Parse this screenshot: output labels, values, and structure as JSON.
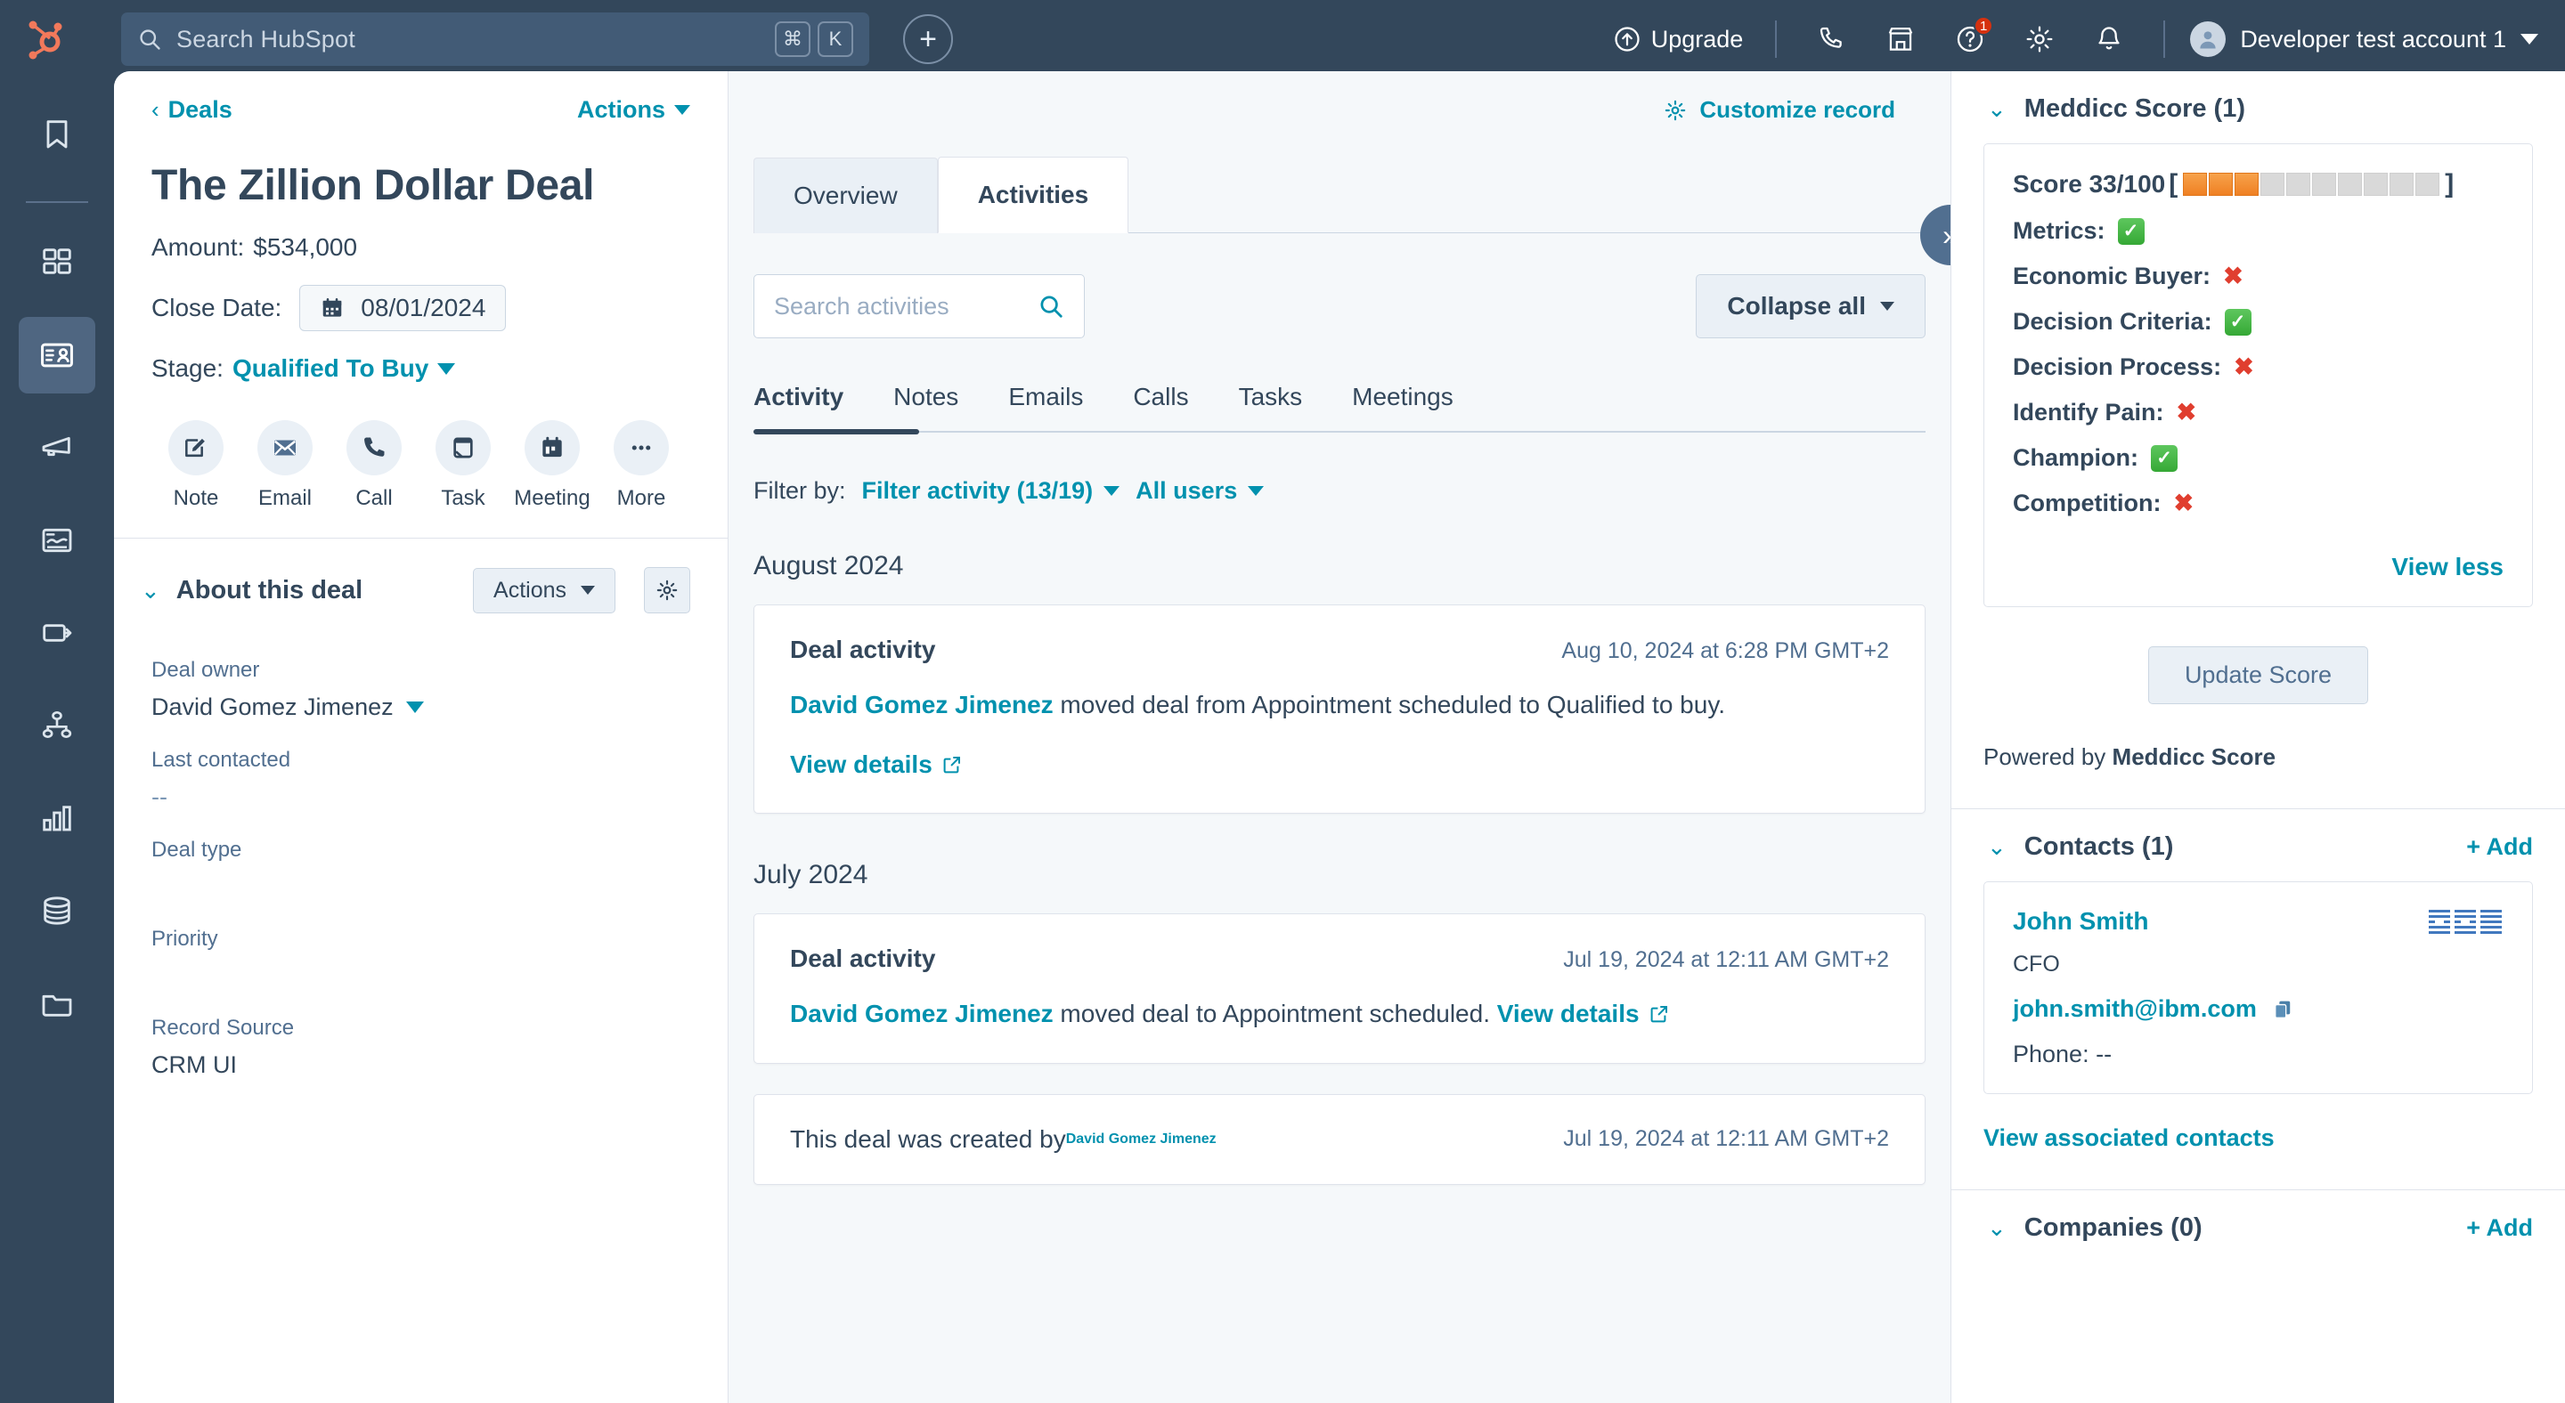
{
  "topnav": {
    "logo_name": "hubspot-logo",
    "search": {
      "placeholder": "Search HubSpot",
      "kbd_cmd": "⌘",
      "kbd_key": "K"
    },
    "create_label": "+",
    "upgrade_label": "Upgrade",
    "icons": [
      "phone-icon",
      "marketplace-icon",
      "help-icon",
      "settings-gear-icon",
      "notifications-bell-icon"
    ],
    "help_badge": "1",
    "account_name": "Developer test account 1"
  },
  "rail": {
    "items": [
      {
        "name": "bookmark-icon",
        "label": "Bookmarks",
        "active": false
      },
      {
        "name": "workspaces-icon",
        "label": "Workspaces",
        "active": false
      },
      {
        "name": "crm-contacts-icon",
        "label": "CRM",
        "active": true
      },
      {
        "name": "marketing-megaphone-icon",
        "label": "Marketing",
        "active": false
      },
      {
        "name": "content-icon",
        "label": "Content",
        "active": false
      },
      {
        "name": "commerce-tag-icon",
        "label": "Commerce",
        "active": false
      },
      {
        "name": "automation-icon",
        "label": "Automations",
        "active": false
      },
      {
        "name": "reporting-bars-icon",
        "label": "Reporting",
        "active": false
      },
      {
        "name": "data-management-icon",
        "label": "Data Management",
        "active": false
      },
      {
        "name": "library-folder-icon",
        "label": "Library",
        "active": false
      }
    ]
  },
  "left": {
    "breadcrumb": "Deals",
    "actions_label": "Actions",
    "deal_title": "The Zillion Dollar Deal",
    "amount_label": "Amount:",
    "amount_value": "$534,000",
    "close_date_label": "Close Date:",
    "close_date_value": "08/01/2024",
    "stage_label": "Stage:",
    "stage_value": "Qualified To Buy",
    "quick_actions": [
      {
        "icon": "note-icon",
        "label": "Note"
      },
      {
        "icon": "email-icon",
        "label": "Email"
      },
      {
        "icon": "call-icon",
        "label": "Call"
      },
      {
        "icon": "task-icon",
        "label": "Task"
      },
      {
        "icon": "meeting-icon",
        "label": "Meeting"
      },
      {
        "icon": "more-icon",
        "label": "More"
      }
    ],
    "about_title": "About this deal",
    "about_actions_label": "Actions",
    "properties": [
      {
        "label": "Deal owner",
        "value": "David Gomez Jimenez",
        "has_caret": true
      },
      {
        "label": "Last contacted",
        "value": "--",
        "has_caret": false
      },
      {
        "label": "Deal type",
        "value": "",
        "has_caret": false
      },
      {
        "label": "Priority",
        "value": "",
        "has_caret": false
      },
      {
        "label": "Record Source",
        "value": "CRM UI",
        "has_caret": false
      }
    ]
  },
  "center": {
    "customize_label": "Customize record",
    "expander_label": "»",
    "tabs": [
      {
        "label": "Overview",
        "active": false
      },
      {
        "label": "Activities",
        "active": true
      }
    ],
    "search_placeholder": "Search activities",
    "collapse_label": "Collapse all",
    "subtabs": [
      {
        "label": "Activity",
        "active": true
      },
      {
        "label": "Notes",
        "active": false
      },
      {
        "label": "Emails",
        "active": false
      },
      {
        "label": "Calls",
        "active": false
      },
      {
        "label": "Tasks",
        "active": false
      },
      {
        "label": "Meetings",
        "active": false
      }
    ],
    "filter_by_label": "Filter by:",
    "filter_activity_label": "Filter activity (13/19)",
    "all_users_label": "All users",
    "groups": [
      {
        "month": "August 2024",
        "cards": [
          {
            "type": "activity",
            "title": "Deal activity",
            "timestamp": "Aug 10, 2024 at 6:28 PM GMT+2",
            "actor": "David Gomez Jimenez",
            "text": " moved deal from Appointment scheduled to Qualified to buy.",
            "view_details": "View details",
            "details_inline": false
          }
        ]
      },
      {
        "month": "July 2024",
        "cards": [
          {
            "type": "activity",
            "title": "Deal activity",
            "timestamp": "Jul 19, 2024 at 12:11 AM GMT+2",
            "actor": "David Gomez Jimenez",
            "text": " moved deal to Appointment scheduled. ",
            "view_details": "View details",
            "details_inline": true
          },
          {
            "type": "simple",
            "prefix": "This deal was created by ",
            "actor": "David Gomez Jimenez",
            "timestamp": "Jul 19, 2024 at 12:11 AM GMT+2"
          }
        ]
      }
    ]
  },
  "right": {
    "meddicc": {
      "title": "Meddicc Score (1)",
      "score_label": "Score 33/100",
      "score_value": 33,
      "score_max": 100,
      "bar_segments_total": 10,
      "bar_segments_filled": 3,
      "bar_fill_color": "#ef8023",
      "bar_empty_color": "#d9d9d9",
      "criteria": [
        {
          "label": "Metrics:",
          "ok": true
        },
        {
          "label": "Economic Buyer:",
          "ok": false
        },
        {
          "label": "Decision Criteria:",
          "ok": true
        },
        {
          "label": "Decision Process:",
          "ok": false
        },
        {
          "label": "Identify Pain:",
          "ok": false
        },
        {
          "label": "Champion:",
          "ok": true
        },
        {
          "label": "Competition:",
          "ok": false
        }
      ],
      "view_less_label": "View less",
      "update_button_label": "Update Score",
      "powered_prefix": "Powered by ",
      "powered_brand": "Meddicc Score"
    },
    "contacts": {
      "title": "Contacts (1)",
      "add_label": "+ Add",
      "items": [
        {
          "name": "John Smith",
          "role": "CFO",
          "email": "john.smith@ibm.com",
          "phone_label": "Phone: --",
          "company_logo": "ibm-logo"
        }
      ],
      "view_associated_label": "View associated contacts"
    },
    "companies": {
      "title": "Companies (0)",
      "add_label": "+ Add"
    }
  }
}
